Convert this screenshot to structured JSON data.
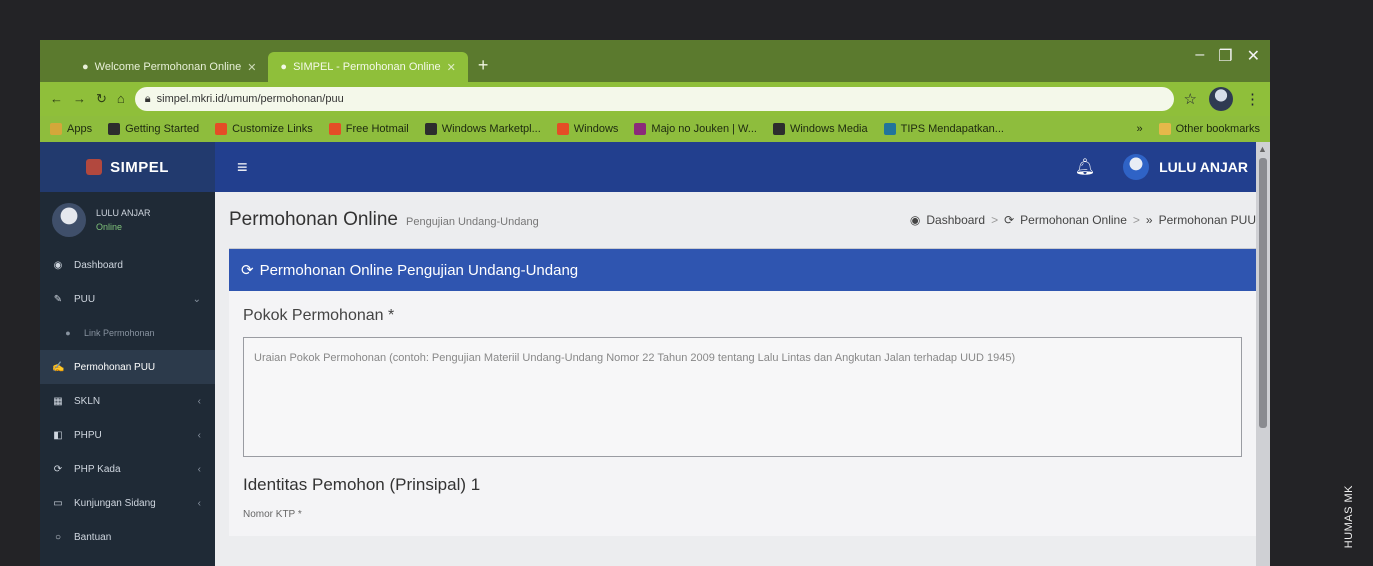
{
  "browser": {
    "tabs": [
      {
        "label": "Welcome Permohonan Online"
      },
      {
        "label": "SIMPEL - Permohonan Online"
      }
    ],
    "new_tab": "+",
    "url": "simpel.mkri.id/umum/permohonan/puu",
    "bookmarks": [
      {
        "label": "Apps",
        "color": "#d4a73a"
      },
      {
        "label": "Getting Started",
        "color": "#2d2d2d"
      },
      {
        "label": "Customize Links",
        "color": "#e44d26"
      },
      {
        "label": "Free Hotmail",
        "color": "#e44d26"
      },
      {
        "label": "Windows Marketpl...",
        "color": "#2d2d2d"
      },
      {
        "label": "Windows",
        "color": "#e44d26"
      },
      {
        "label": "Majo no Jouken | W...",
        "color": "#8b2a7a"
      },
      {
        "label": "Windows Media",
        "color": "#2d2d2d"
      },
      {
        "label": "TIPS Mendapatkan...",
        "color": "#21759b"
      }
    ],
    "overflow": "»",
    "other_bookmarks": "Other bookmarks"
  },
  "app": {
    "brand": "SIMPEL",
    "user": {
      "name": "LULU ANJAR",
      "status": "Online"
    },
    "menu": [
      {
        "label": "Dashboard",
        "icon": "dashboard-icon",
        "glyph": "◉",
        "type": "item"
      },
      {
        "label": "PUU",
        "icon": "puu-icon",
        "glyph": "✎",
        "type": "item",
        "chevron": "⌄"
      },
      {
        "label": "Link Permohonan",
        "icon": "link-icon",
        "glyph": "●",
        "type": "sub"
      },
      {
        "label": "Permohonan PUU",
        "icon": "edit-icon",
        "glyph": "✍",
        "type": "active"
      },
      {
        "label": "SKLN",
        "icon": "skln-icon",
        "glyph": "▦",
        "type": "item",
        "chevron": "‹"
      },
      {
        "label": "PHPU",
        "icon": "phpu-icon",
        "glyph": "◧",
        "type": "item",
        "chevron": "‹"
      },
      {
        "label": "PHP Kada",
        "icon": "phpkada-icon",
        "glyph": "⟳",
        "type": "item",
        "chevron": "‹"
      },
      {
        "label": "Kunjungan Sidang",
        "icon": "calendar-icon",
        "glyph": "▭",
        "type": "item",
        "chevron": "‹"
      },
      {
        "label": "Bantuan",
        "icon": "help-icon",
        "glyph": "○",
        "type": "item"
      }
    ],
    "topbar": {
      "user": "LULU ANJAR"
    },
    "header": {
      "title": "Permohonan Online",
      "subtitle": "Pengujian Undang-Undang"
    },
    "breadcrumb": [
      "Dashboard",
      "Permohonan Online",
      "Permohonan PUU"
    ],
    "panel": {
      "title": "Permohonan Online Pengujian Undang-Undang",
      "field_label": "Pokok Permohonan *",
      "placeholder": "Uraian Pokok Permohonan (contoh: Pengujian Materiil Undang-Undang Nomor 22 Tahun 2009 tentang Lalu Lintas dan Angkutan Jalan terhadap UUD 1945)",
      "section": "Identitas Pemohon (Prinsipal) 1",
      "ktp_label": "Nomor KTP *"
    }
  },
  "watermark": "HUMAS MK"
}
